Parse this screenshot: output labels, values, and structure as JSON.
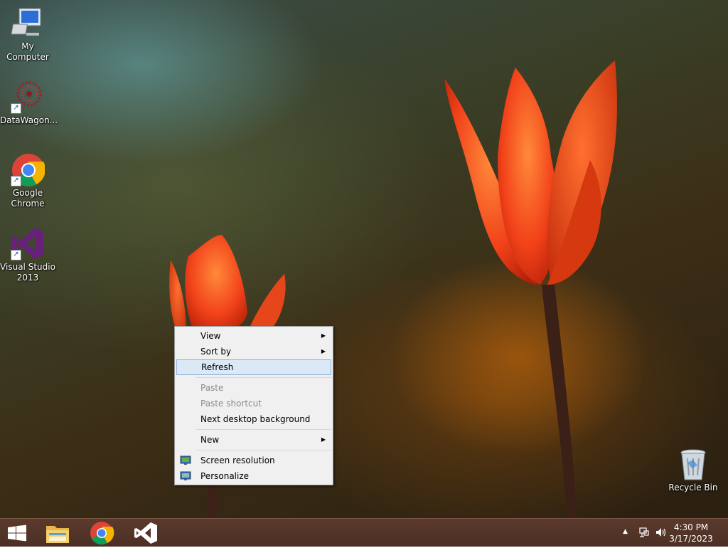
{
  "desktop": {
    "icons": [
      {
        "label": "My Computer",
        "icon": "my-computer-icon"
      },
      {
        "label": "DataWagon...",
        "icon": "datawagon-icon"
      },
      {
        "label": "Google Chrome",
        "icon": "chrome-icon"
      },
      {
        "label": "Visual Studio 2013",
        "icon": "visual-studio-icon"
      },
      {
        "label": "Recycle Bin",
        "icon": "recycle-bin-icon"
      }
    ]
  },
  "context_menu": {
    "items": [
      {
        "label": "View",
        "submenu": true
      },
      {
        "label": "Sort by",
        "submenu": true
      },
      {
        "label": "Refresh",
        "highlighted": true
      },
      {
        "label": "Paste",
        "disabled": true
      },
      {
        "label": "Paste shortcut",
        "disabled": true
      },
      {
        "label": "Next desktop background"
      },
      {
        "label": "New",
        "submenu": true
      },
      {
        "label": "Screen resolution",
        "icon": "screen-resolution-icon"
      },
      {
        "label": "Personalize",
        "icon": "personalize-icon"
      }
    ],
    "highlight_color": "#dbe8f6"
  },
  "taskbar": {
    "buttons": [
      "start-icon",
      "file-explorer-icon",
      "chrome-icon",
      "visual-studio-icon"
    ],
    "tray": {
      "icons": [
        "show-hidden-icons-icon",
        "network-icon",
        "volume-icon"
      ],
      "time": "4:30 PM",
      "date": "3/17/2023"
    },
    "color": "#4e3126"
  }
}
